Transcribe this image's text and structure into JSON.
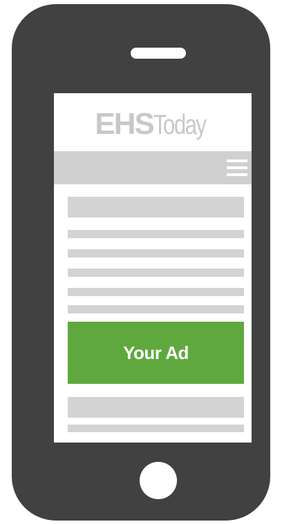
{
  "logo": {
    "bold_text": "EHS",
    "light_text": "Today"
  },
  "ad": {
    "label": "Your Ad"
  },
  "colors": {
    "phone_body": "#414141",
    "screen_background": "#ffffff",
    "placeholder_gray": "#d3d3d3",
    "ad_green": "#5fa83e",
    "logo_gray": "#c8c8c8"
  },
  "icons": {
    "menu": "hamburger-menu-icon",
    "home": "home-button-circle",
    "speaker": "speaker-slot"
  }
}
